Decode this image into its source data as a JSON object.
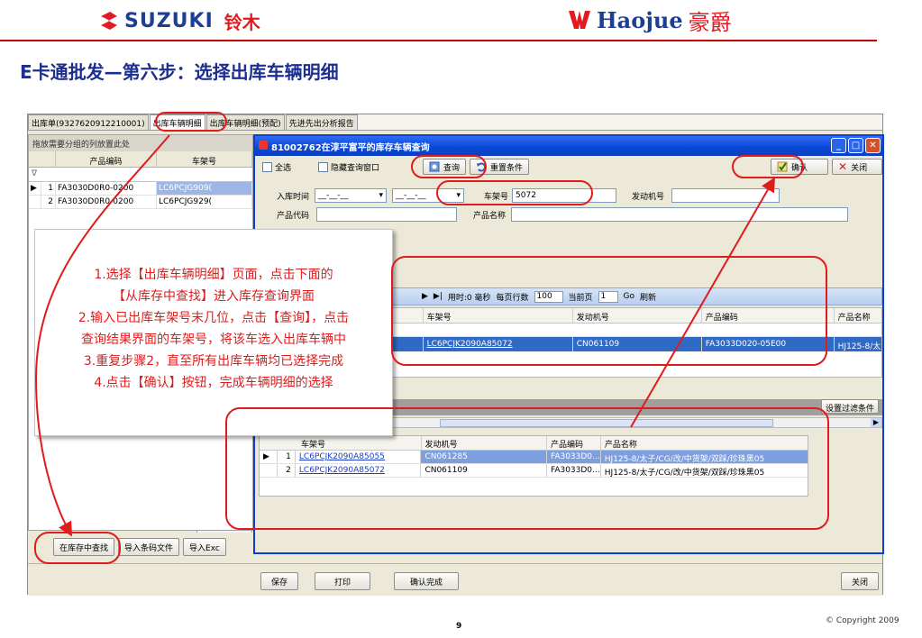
{
  "header": {
    "suzuki_name": "SUZUKI",
    "suzuki_cn": "铃木",
    "haojue_name": "Haojue",
    "haojue_cn": "豪爵"
  },
  "slide_title": "E卡通批发—第六步：选择出库车辆明细",
  "tabs": [
    {
      "label": "出库单(9327620912210001)"
    },
    {
      "label": "出库车辆明细"
    },
    {
      "label": "出库车辆明细(预配)"
    },
    {
      "label": "先进先出分析报告"
    }
  ],
  "left_grid": {
    "group_hint": "拖放需要分组的列放置此处",
    "columns": [
      "产品编码",
      "车架号"
    ],
    "filter_icon": "∇",
    "rows": [
      {
        "num": "1",
        "code": "FA3030D0R0-0200",
        "frame": "LC6PCJG909("
      },
      {
        "num": "2",
        "code": "FA3030D0R0-0200",
        "frame": "LC6PCJG929("
      }
    ]
  },
  "left_buttons": {
    "search_stock": "在库存中查找",
    "import_barcode": "导入条码文件",
    "import_excel": "导入Exc"
  },
  "footer_buttons": {
    "save": "保存",
    "print": "打印",
    "confirm_complete": "确认完成",
    "close": "关闭"
  },
  "dialog": {
    "title": "81002762在淳平富平的库存车辆查询",
    "select_all": "全选",
    "hide_window": "隐藏查询窗口",
    "query": "查询",
    "reset": "重置条件",
    "confirm": "确认",
    "close": "关闭",
    "in_time_label": "入库时间",
    "date_placeholder": "__-__-__",
    "frame_label": "车架号",
    "frame_value": "5072",
    "engine_label": "发动机号",
    "product_code_label": "产品代码",
    "product_name_label": "产品名称",
    "pager": {
      "elapsed": "用时:0 毫秒",
      "per_page_label": "每页行数",
      "per_page": "100",
      "current_label": "当前页",
      "current": "1",
      "go": "Go",
      "refresh": "刷新"
    },
    "result_columns": [
      "车架号",
      "发动机号",
      "产品编码",
      "产品名称"
    ],
    "result_row": {
      "frame": "LC6PCJK2090A85072",
      "engine": "CN061109",
      "code": "FA3033D020-05E00",
      "name": "HJ125-8/太"
    },
    "filter_setting": "设置过滤条件",
    "selected_columns": [
      "车架号",
      "发动机号",
      "产品编码",
      "产品名称"
    ],
    "selected_rows": [
      {
        "num": "1",
        "frame": "LC6PCJK2090A85055",
        "engine": "CN061285",
        "code": "FA3033D0...",
        "name": "HJ125-8/太子/CG/改/中货架/双踩/珍珠黑05"
      },
      {
        "num": "2",
        "frame": "LC6PCJK2090A85072",
        "engine": "CN061109",
        "code": "FA3033D0...",
        "name": "HJ125-8/太子/CG/改/中货架/双踩/珍珠黑05"
      }
    ]
  },
  "instructions": [
    "1.选择【出库车辆明细】页面，点击下面的",
    "【从库存中查找】进入库存查询界面",
    "2.输入已出库车架号末几位，点击【查询】，点击",
    "查询结果界面的车架号，将该车选入出库车辆中",
    "3.重复步骤2，直至所有出库车辆均已选择完成",
    "4.点击【确认】按钮，完成车辆明细的选择"
  ],
  "page_number": "9",
  "copyright": "© Copyright  2009",
  "colors": {
    "accent_red": "#e01b1b",
    "brand_blue": "#1c3f94",
    "title_blue": "#1c2f8f",
    "xp_titlebar": "#0a48d6"
  }
}
